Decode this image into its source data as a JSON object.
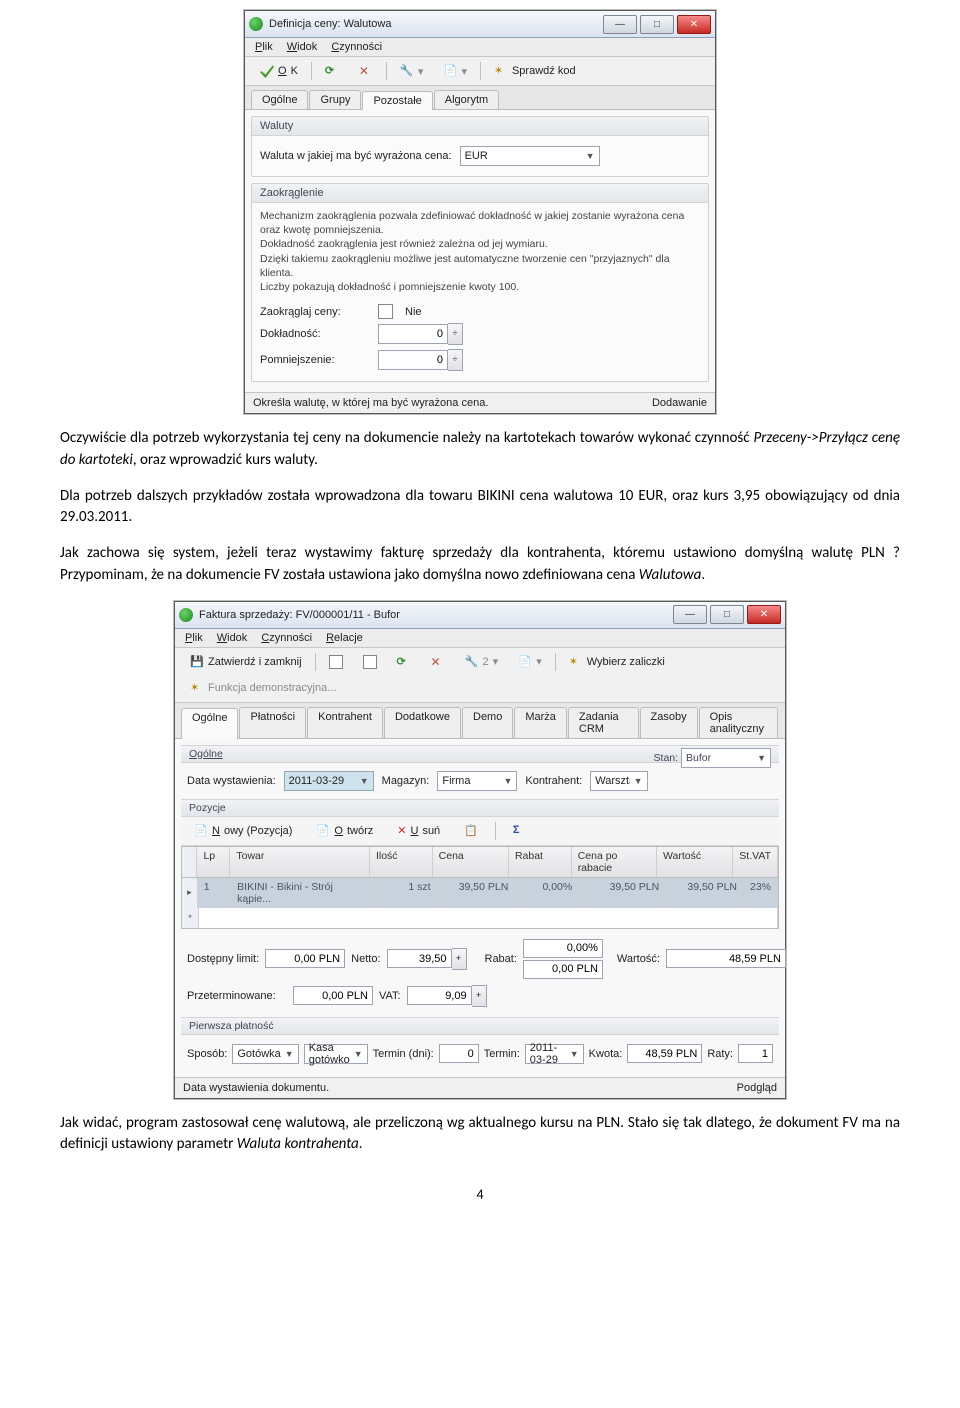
{
  "win1": {
    "title": "Definicja ceny: Walutowa",
    "menu": {
      "plik": "Plik",
      "widok": "Widok",
      "czynnosci": "Czynności"
    },
    "toolbar": {
      "ok": "OK",
      "sprawdz": "Sprawdź kod"
    },
    "tabs": {
      "ogolne": "Ogólne",
      "grupy": "Grupy",
      "pozostale": "Pozostałe",
      "algorytm": "Algorytm"
    },
    "waluty": {
      "header": "Waluty",
      "label": "Waluta w jakiej ma być wyrażona cena:",
      "value": "EUR"
    },
    "zaokr": {
      "header": "Zaokrąglenie",
      "d1": "Mechanizm zaokrąglenia pozwala zdefiniować dokładność w jakiej zostanie wyrażona cena oraz kwotę pomniejszenia.",
      "d2": "Dokładność zaokrąglenia jest również zależna od jej wymiaru.",
      "d3": "Dzięki takiemu zaokrągleniu możliwe jest automatyczne tworzenie cen \"przyjaznych\" dla klienta.",
      "d4": "Liczby pokazują dokładność i pomniejszenie kwoty 100.",
      "l1": "Zaokrąglaj ceny:",
      "v1": "Nie",
      "l2": "Dokładność:",
      "v2": "0",
      "l3": "Pomniejszenie:",
      "v3": "0"
    },
    "status": {
      "left": "Określa walutę, w której ma być wyrażona cena.",
      "right": "Dodawanie"
    }
  },
  "p1": "Oczywiście dla potrzeb wykorzystania tej ceny na dokumencie należy na kartotekach towarów wykonać czynność ",
  "p1i": "Przeceny->Przyłącz cenę do kartoteki",
  "p1b": ", oraz wprowadzić kurs waluty.",
  "p2": "Dla potrzeb dalszych przykładów została wprowadzona dla towaru BIKINI cena walutowa 10 EUR, oraz kurs 3,95 obowiązujący od dnia 29.03.2011.",
  "p3a": "Jak zachowa się system, jeżeli teraz wystawimy fakturę sprzedaży dla kontrahenta, któremu ustawiono domyślną walutę PLN ? Przypominam, że na dokumencie FV została ustawiona jako domyślna nowo zdefiniowana cena ",
  "p3i": "Walutowa",
  "p3b": ".",
  "win2": {
    "title": "Faktura sprzedaży: FV/000001/11 - Bufor",
    "menu": {
      "plik": "Plik",
      "widok": "Widok",
      "czynnosci": "Czynności",
      "relacje": "Relacje"
    },
    "toolbar": {
      "zatw": "Zatwierdź i zamknij",
      "wyb": "Wybierz zaliczki",
      "func": "Funkcja demonstracyjna...",
      "num": "2"
    },
    "tabs": {
      "ogolne": "Ogólne",
      "platnosci": "Płatności",
      "kontrahent": "Kontrahent",
      "dodatkowe": "Dodatkowe",
      "demo": "Demo",
      "marza": "Marża",
      "zadania": "Zadania CRM",
      "zasoby": "Zasoby",
      "opis": "Opis analityczny"
    },
    "hdr": {
      "ogolne": "Ogólne",
      "stan_l": "Stan:",
      "stan": "Bufor",
      "data_l": "Data wystawienia:",
      "data": "2011-03-29",
      "mag_l": "Magazyn:",
      "mag": "Firma",
      "kon_l": "Kontrahent:",
      "kon": "Warsztat Samochodowy DRYNDA Wiesław Goluc"
    },
    "poz": {
      "header": "Pozycje",
      "nowy": "Nowy (Pozycja)",
      "otworz": "Otwórz",
      "usun": "Usuń",
      "cols": {
        "lp": "Lp",
        "towar": "Towar",
        "ilosc": "Ilość",
        "cena": "Cena",
        "rabat": "Rabat",
        "cpr": "Cena po rabacie",
        "wartosc": "Wartość",
        "stvat": "St.VAT"
      },
      "row": {
        "lp": "1",
        "towar": "BIKINI - Bikini - Strój kąpie...",
        "ilosc": "1 szt",
        "cena": "39,50 PLN",
        "rabat": "0,00%",
        "cpr": "39,50 PLN",
        "wartosc": "39,50 PLN",
        "stvat": "23%"
      }
    },
    "sum": {
      "dl_l": "Dostępny limit:",
      "dl": "0,00 PLN",
      "net_l": "Netto:",
      "net": "39,50",
      "rab_l": "Rabat:",
      "rab": "0,00%",
      "rabk": "0,00 PLN",
      "prz_l": "Przeterminowane:",
      "prz": "0,00 PLN",
      "vat_l": "VAT:",
      "vat": "9,09",
      "wart_l": "Wartość:",
      "wart": "48,59 PLN"
    },
    "pp": {
      "header": "Pierwsza płatność",
      "sp_l": "Sposób:",
      "sp": "Gotówka",
      "kasa": "Kasa gotówko",
      "td_l": "Termin (dni):",
      "td": "0",
      "t_l": "Termin:",
      "t": "2011-03-29",
      "kw_l": "Kwota:",
      "kw": "48,59 PLN",
      "raty_l": "Raty:",
      "raty": "1"
    },
    "status": {
      "left": "Data wystawienia dokumentu.",
      "right": "Podgląd"
    }
  },
  "p4a": "Jak widać, program zastosował cenę walutową, ale przeliczoną wg aktualnego kursu na PLN. Stało się tak dlatego, że dokument FV ma na definicji ustawiony parametr ",
  "p4i": "Waluta kontrahenta",
  "p4b": ".",
  "pagenum": "4"
}
